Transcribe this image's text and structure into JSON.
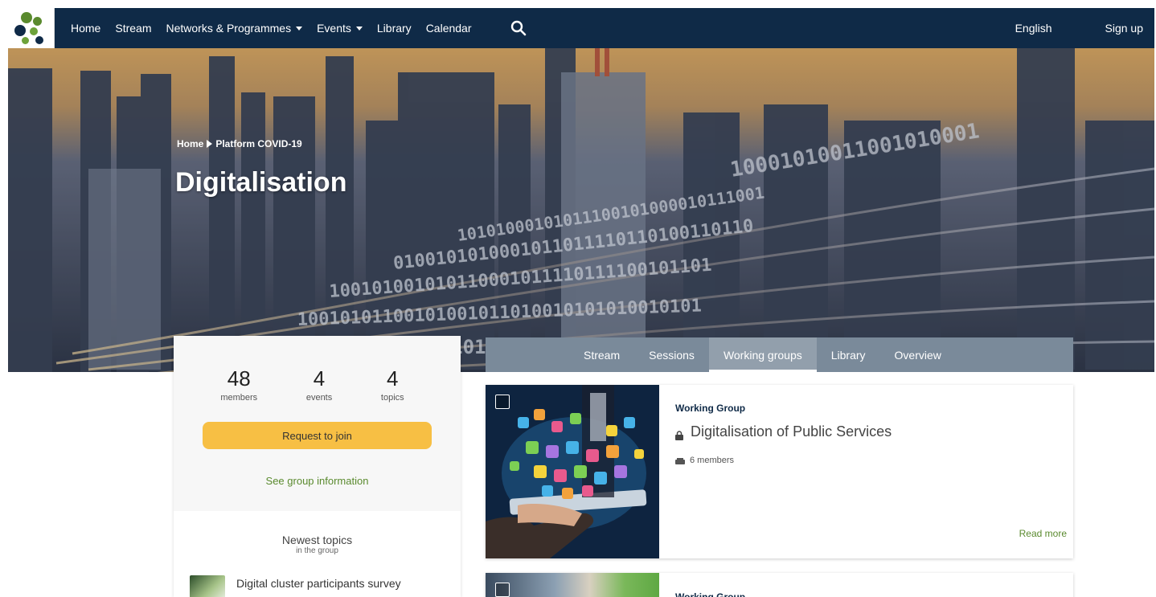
{
  "nav": {
    "items": [
      {
        "label": "Home"
      },
      {
        "label": "Stream"
      },
      {
        "label": "Networks & Programmes",
        "dropdown": true
      },
      {
        "label": "Events",
        "dropdown": true
      },
      {
        "label": "Library"
      },
      {
        "label": "Calendar"
      }
    ],
    "language": "English",
    "signup": "Sign up",
    "background_color": "#0f2a47"
  },
  "breadcrumb": {
    "home": "Home",
    "current": "Platform COVID-19"
  },
  "page_title": "Digitalisation",
  "group_stats": [
    {
      "value": "48",
      "label": "members"
    },
    {
      "value": "4",
      "label": "events"
    },
    {
      "value": "4",
      "label": "topics"
    }
  ],
  "join_button": "Request to join",
  "group_info_link": "See group information",
  "newest_topics": {
    "title": "Newest topics",
    "subtitle": "in the group",
    "items": [
      {
        "title": "Digital cluster participants survey"
      }
    ]
  },
  "tabs": [
    {
      "label": "Stream"
    },
    {
      "label": "Sessions"
    },
    {
      "label": "Working groups",
      "active": true
    },
    {
      "label": "Library"
    },
    {
      "label": "Overview"
    }
  ],
  "working_groups": [
    {
      "type": "Working Group",
      "title": "Digitalisation of Public Services",
      "members": "6 members",
      "read_more": "Read more"
    },
    {
      "type": "Working Group"
    }
  ],
  "colors": {
    "accent_button": "#f7bf44",
    "link_green": "#5a8a2e",
    "tab_bar": "#7a8a9a"
  }
}
